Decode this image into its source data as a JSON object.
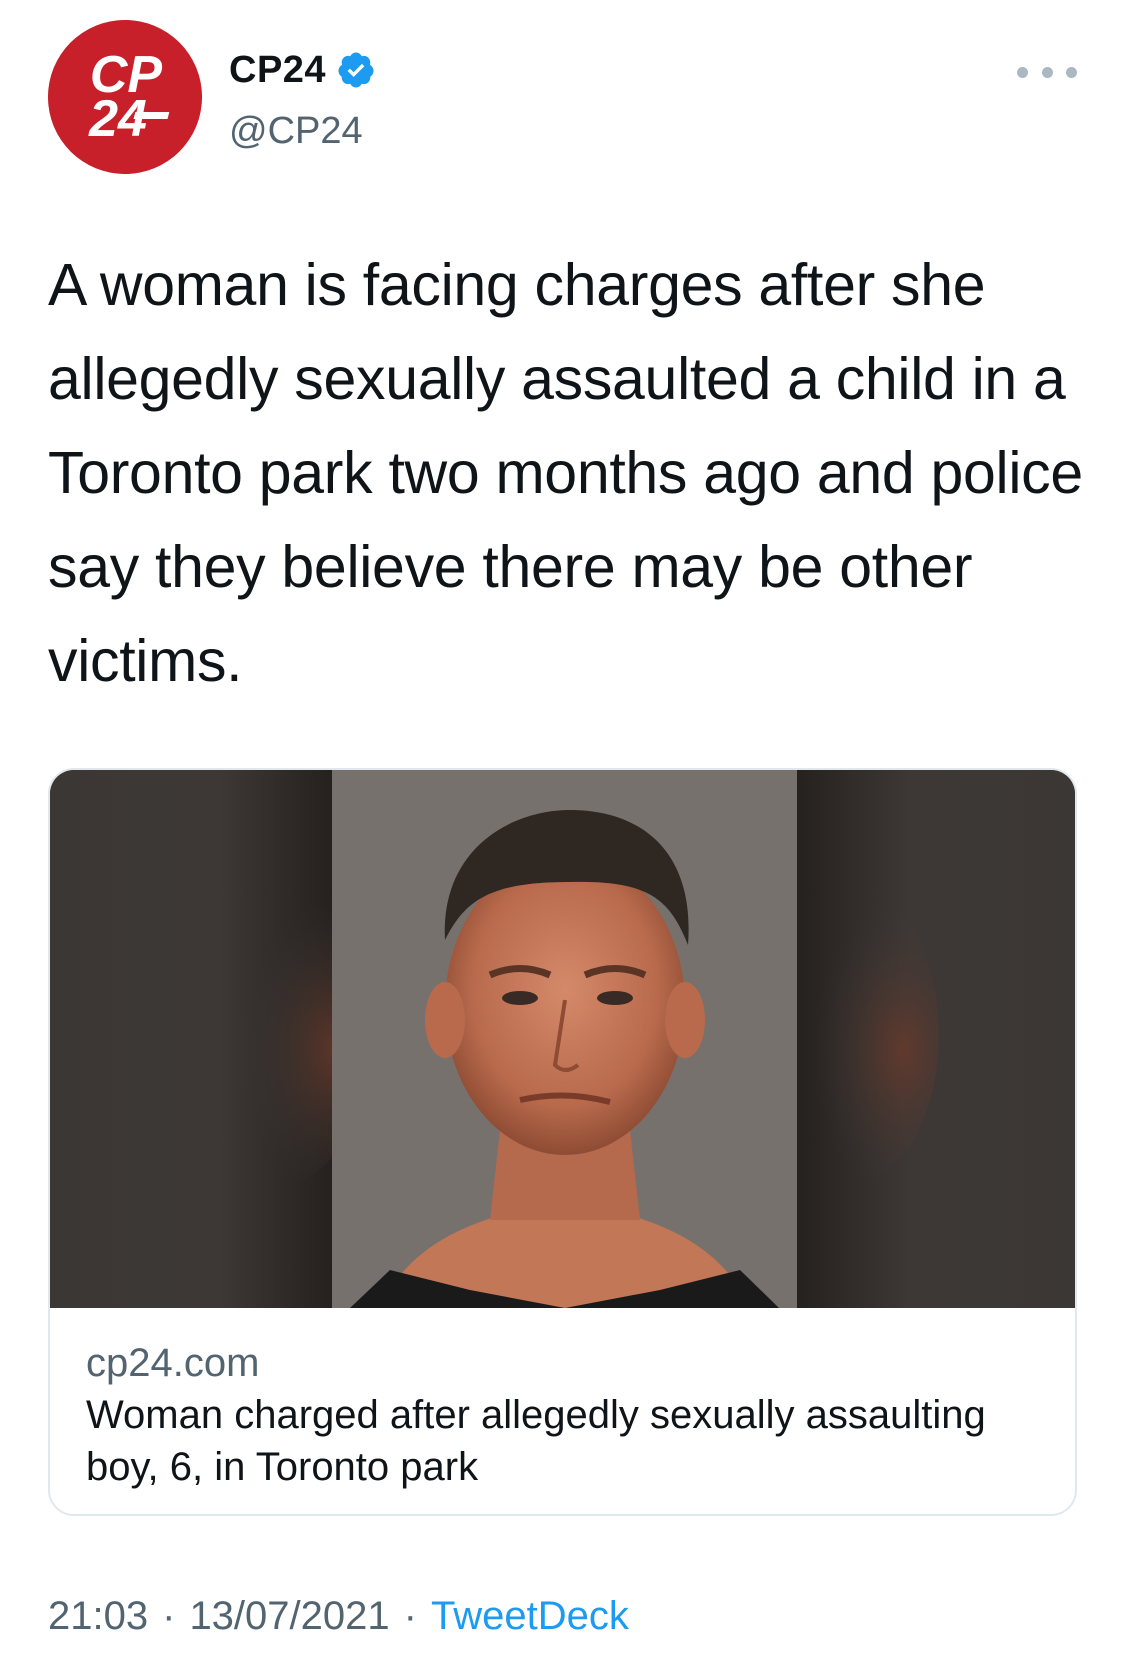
{
  "author": {
    "avatar_text_top": "CP",
    "avatar_text_bottom": "24",
    "display_name": "CP24",
    "handle": "@CP24",
    "verified": true,
    "avatar_color": "#c8202a"
  },
  "tweet": {
    "text": "A woman is facing charges after she allegedly sexually assaulted a child in a Toronto park two months ago and police say they believe there may be other victims."
  },
  "card": {
    "domain": "cp24.com",
    "title": "Woman charged after allegedly sexually assaulting boy, 6, in Toronto park"
  },
  "footer": {
    "time": "21:03",
    "date": "13/07/2021",
    "separator": "·",
    "source": "TweetDeck"
  },
  "colors": {
    "accent": "#1d9bf0",
    "text_primary": "#0f1419",
    "text_secondary": "#536471",
    "border": "#e1e8ed"
  }
}
